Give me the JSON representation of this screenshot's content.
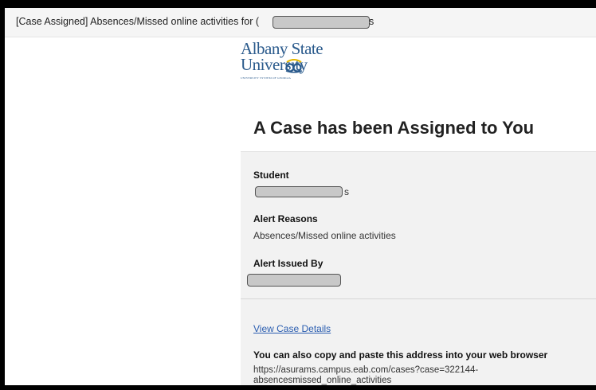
{
  "email": {
    "subject_prefix": "[Case Assigned] Absences/Missed online activities for (",
    "subject_suffix": "s"
  },
  "logo": {
    "line1": "Albany State",
    "line2": "University",
    "subline": "UNIVERSITY SYSTEM OF GEORGIA"
  },
  "heading": "A Case has been Assigned to You",
  "details": {
    "student_label": "Student",
    "student_suffix": "s",
    "alert_reasons_label": "Alert Reasons",
    "alert_reasons_value": "Absences/Missed online activities",
    "alert_issued_by_label": "Alert Issued By"
  },
  "footer": {
    "view_link": "View Case Details",
    "copy_label": "You can also copy and paste this address into your web browser",
    "url_line1": "https://asurams.campus.eab.com/cases?case=322144-",
    "url_line2": "absencesmissed_online_activities"
  },
  "colors": {
    "brand_blue": "#2a5a8c",
    "link": "#2a5db0",
    "card_bg": "#f2f2f2"
  }
}
